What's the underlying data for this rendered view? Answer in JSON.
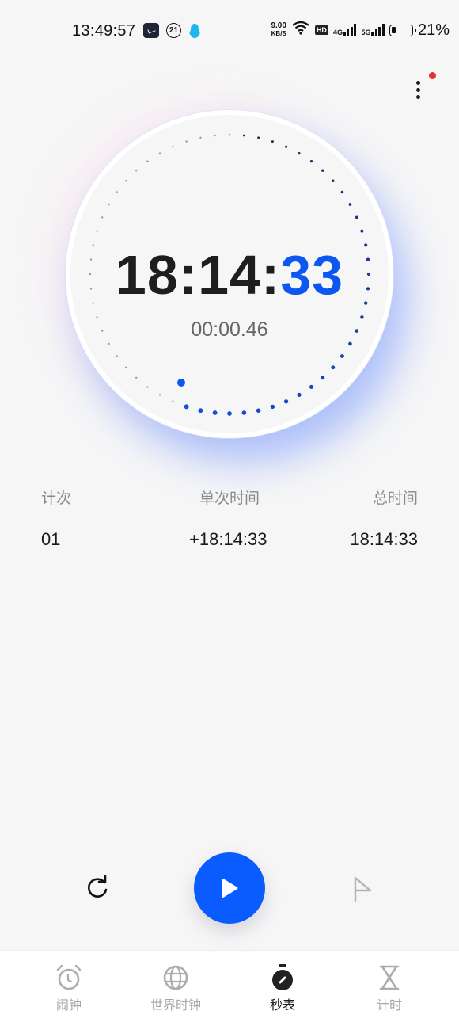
{
  "status_bar": {
    "time": "13:49:57",
    "notification_icons": [
      "clock-app-icon",
      "badge-21-icon",
      "qq-penguin-icon"
    ],
    "badge_number": "21",
    "net_speed_value": "9.00",
    "net_speed_unit": "KB/S",
    "hd_label": "HD",
    "signal1_label": "4G",
    "signal2_label": "5G",
    "battery_percent": "21%"
  },
  "menu": {
    "more_icon": "more-vertical-icon",
    "has_notification_dot": true,
    "dot_color": "#e5322d"
  },
  "stopwatch": {
    "main_time_prefix": "18:14:",
    "main_time_seconds": "33",
    "sub_time": "00:00.46",
    "accent_color": "#0b57f0",
    "dial": {
      "total_ticks": 60,
      "progress_seconds": 33,
      "indicator_position_seconds": 34
    }
  },
  "laps": {
    "headers": {
      "index": "计次",
      "split": "单次时间",
      "total": "总时间"
    },
    "rows": [
      {
        "index": "01",
        "split": "+18:14:33",
        "total": "18:14:33"
      }
    ]
  },
  "controls": {
    "reset_icon": "reset-icon",
    "play_icon": "play-icon",
    "lap_icon": "flag-icon",
    "play_color": "#0b5cff"
  },
  "tabs": [
    {
      "label": "闹钟",
      "icon": "alarm-clock-icon",
      "active": false
    },
    {
      "label": "世界时钟",
      "icon": "globe-icon",
      "active": false
    },
    {
      "label": "秒表",
      "icon": "stopwatch-icon",
      "active": true
    },
    {
      "label": "计时",
      "icon": "hourglass-icon",
      "active": false
    }
  ]
}
